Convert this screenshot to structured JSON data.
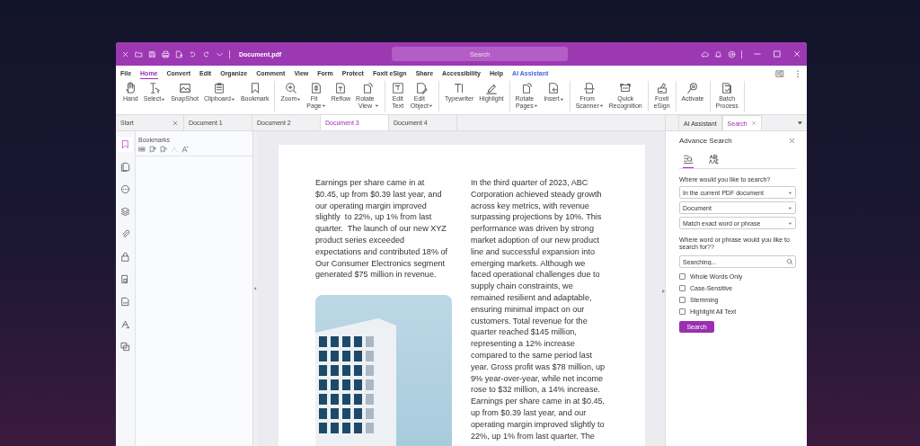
{
  "title_bar": {
    "file_name": "Document.pdf",
    "search_placeholder": "Search"
  },
  "menu": [
    {
      "label": "File",
      "selected": false,
      "kind": "plain"
    },
    {
      "label": "Home",
      "selected": true,
      "kind": "plain"
    },
    {
      "label": "Convert",
      "selected": false,
      "kind": "plain"
    },
    {
      "label": "Edit",
      "selected": false,
      "kind": "plain"
    },
    {
      "label": "Organize",
      "selected": false,
      "kind": "plain"
    },
    {
      "label": "Comment",
      "selected": false,
      "kind": "plain"
    },
    {
      "label": "View",
      "selected": false,
      "kind": "plain"
    },
    {
      "label": "Form",
      "selected": false,
      "kind": "plain"
    },
    {
      "label": "Protect",
      "selected": false,
      "kind": "plain"
    },
    {
      "label": "Foxit eSign",
      "selected": false,
      "kind": "plain"
    },
    {
      "label": "Share",
      "selected": false,
      "kind": "plain"
    },
    {
      "label": "Accessibility",
      "selected": false,
      "kind": "plain"
    },
    {
      "label": "Help",
      "selected": false,
      "kind": "plain"
    },
    {
      "label": "AI Assistant",
      "selected": false,
      "kind": "ai"
    }
  ],
  "ribbon": [
    [
      {
        "label": "Hand",
        "dropdown": false
      },
      {
        "label": "Select",
        "dropdown": true
      },
      {
        "label": "SnapShot",
        "dropdown": false
      },
      {
        "label": "Clipboard",
        "dropdown": true
      },
      {
        "label": "Bookmark",
        "dropdown": false
      }
    ],
    [
      {
        "label": "Zoom",
        "dropdown": true
      },
      {
        "label": "Fit\nPage",
        "dropdown": true
      },
      {
        "label": "Reflow",
        "dropdown": false
      },
      {
        "label": "Rotate\nView",
        "dropdown": true
      }
    ],
    [
      {
        "label": "Edit\nText",
        "dropdown": false
      },
      {
        "label": "Edit\nObject",
        "dropdown": true
      }
    ],
    [
      {
        "label": "Typewriter",
        "dropdown": false
      },
      {
        "label": "Highlight",
        "dropdown": false
      }
    ],
    [
      {
        "label": "Rotate\nPages",
        "dropdown": true
      },
      {
        "label": "Insert",
        "dropdown": true
      }
    ],
    [
      {
        "label": "From\nScanner",
        "dropdown": true
      },
      {
        "label": "Quick\nRecognition",
        "dropdown": false
      }
    ],
    [
      {
        "label": "Foxit\neSign",
        "dropdown": false
      }
    ],
    [
      {
        "label": "Activate",
        "dropdown": false
      }
    ],
    [
      {
        "label": "Batch\nProcess",
        "dropdown": false
      }
    ]
  ],
  "doc_tabs": [
    {
      "label": "Start",
      "selected": false,
      "closable": true
    },
    {
      "label": "Document 1",
      "selected": false,
      "closable": false
    },
    {
      "label": "Document 2",
      "selected": false,
      "closable": false
    },
    {
      "label": "Document 3",
      "selected": true,
      "closable": false
    },
    {
      "label": "Document 4",
      "selected": false,
      "closable": false
    }
  ],
  "sidebar": [
    {
      "selected": true
    },
    {
      "selected": false
    },
    {
      "selected": false
    },
    {
      "selected": false
    },
    {
      "selected": false
    },
    {
      "selected": false
    },
    {
      "selected": false
    },
    {
      "selected": false
    },
    {
      "selected": false
    },
    {
      "selected": false
    }
  ],
  "left_panel": {
    "title": "Bookmarks"
  },
  "document": {
    "column_1": "Earnings per share came in at\n$0.45, up from $0.39 last year, and\nour operating margin improved\nslightly  to 22%, up 1% from last\nquarter.  The launch of our new XYZ\nproduct series exceeded\nexpectations and contributed 18% of\nOur Consumer Electronics segment\ngenerated $75 million in revenue.",
    "column_2": "In the third quarter of 2023, ABC\nCorporation achieved steady growth\nacross key metrics, with revenue\nsurpassing projections by 10%. This\nperformance was driven by strong\nmarket adoption of our new product\nline and successful expansion into\nemerging markets. Although we\nfaced operational challenges due to\nsupply chain constraints, we\nremained resilient and adaptable,\nensuring minimal impact on our\ncustomers. Total revenue for the\nquarter reached $145 million,\nrepresenting a 12% increase\ncompared to the same period last\nyear. Gross profit was $78 million, up\n9% year-over-year, while net income\nrose to $32 million, a 14% increase.\nEarnings per share came in at $0.45,\nup from $0.39 last year, and our\noperating margin improved slightly to\n22%, up 1% from last quarter. The"
  },
  "right_panel": {
    "tabs": [
      {
        "label": "AI Assistant",
        "selected": false,
        "closable": false
      },
      {
        "label": "Search",
        "selected": true,
        "closable": true
      }
    ],
    "title": "Advance Search",
    "mode_tabs": [
      {
        "selected": true
      },
      {
        "selected": false
      }
    ],
    "scope_label": "Where would you like to search?",
    "dropdowns": [
      "In the current PDF document",
      "Document",
      "Match exact word or phrase"
    ],
    "query_label": "Where word or phrase would you like to search for??",
    "query": {
      "placeholder": "Searching..."
    },
    "options": [
      {
        "label": "Whole Words Only",
        "checked": false
      },
      {
        "label": "Case-Sensitive",
        "checked": false
      },
      {
        "label": "Stemming",
        "checked": false
      },
      {
        "label": "Highlight All Text",
        "checked": false
      }
    ],
    "button": "Search"
  }
}
